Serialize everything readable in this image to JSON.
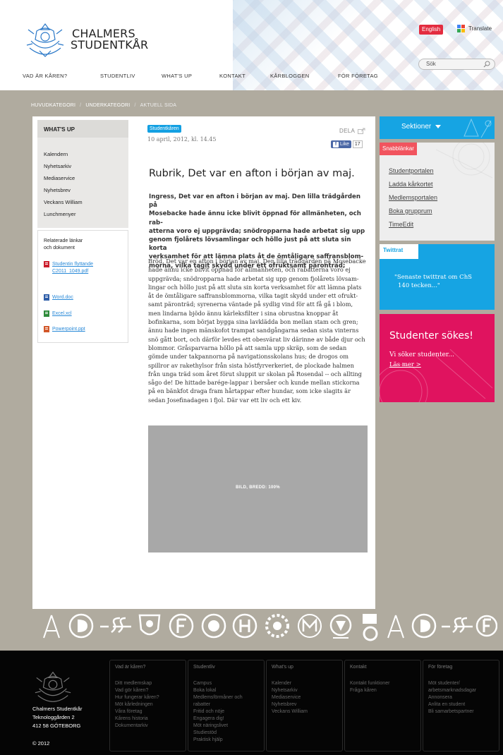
{
  "header": {
    "logo_line1": "CHALMERS",
    "logo_line2": "STUDENTKÅR",
    "lang_button": "English",
    "translate_label": "Translate",
    "search_placeholder": "Sök",
    "nav": [
      "VAD ÄR KÅREN?",
      "STUDENTLIV",
      "WHAT'S UP",
      "KONTAKT",
      "KÅRBLOGGEN",
      "FÖR FÖRETAG"
    ]
  },
  "breadcrumb": [
    "HUVUDKATEGORI",
    "UNDERKATEGORI",
    "AKTUELL SIDA"
  ],
  "sidebar": {
    "title": "WHAT'S UP",
    "items": [
      "Kalendern",
      "Nyhetsarkiv",
      "Mediaservice",
      "Nyhetsbrev",
      "Veckans William",
      "Lunchmenyer"
    ],
    "related_title_1": "Relaterade länkar",
    "related_title_2": "och dokument",
    "docs": [
      {
        "line1": "Studentin flyttande",
        "line2": "C2011_1049.pdf",
        "icon": "pdf-icon",
        "color": "#cc1f2d"
      },
      {
        "line1": "Word.doc",
        "line2": "",
        "icon": "word-icon",
        "color": "#2f5ea8"
      },
      {
        "line1": "Excel.xcl",
        "line2": "",
        "icon": "excel-icon",
        "color": "#2e8b3a"
      },
      {
        "line1": "Powerpoint.ppt",
        "line2": "",
        "icon": "powerpoint-icon",
        "color": "#d2582a"
      }
    ]
  },
  "article": {
    "tag": "Studentkåren",
    "date": "10 april, 2012, kl. 14.45",
    "share_label": "DELA",
    "like_label": "Like",
    "like_count": "17",
    "title": "Rubrik, Det var en afton i början av maj.",
    "ingress_lines": [
      "Ingress, Det var en afton i början av maj. Den lilla trädgården på",
      "Mosebacke hade ännu icke blivit öppnad för allmänheten, och rab-",
      "atterna voro ej uppgrävda; snödropparna hade arbetat sig upp",
      "genom fjolårets lövsamlingar och höllo just på att sluta sin korta",
      "verksamhet för att lämna plats åt de ömtåligare saffransblom-",
      "morna, vilka tagit skydd under ett ofruktsamt päronträd;"
    ],
    "body_lines": [
      "Bröd, Det var en afton i början av maj. Den lilla trädgården på Mosebacke",
      "hade ännu icke blivit öppnad för allmänheten, och rabatterna voro ej",
      "uppgrävda; snödropparna hade arbetat sig upp genom fjolårets lövsam-",
      "lingar och höllo just på att sluta sin korta verksamhet för att lämna plats",
      "åt de ömtåligare saffransblommorna, vilka tagit skydd under ett ofrukt-",
      "samt päronträd; syrenerna väntade på sydlig vind för att få gå i blom,",
      "men lindarna bjödo ännu kärleksfilter i sina obrustna knoppar åt",
      "bofinkarna, som börjat bygga sina lavklädda bon mellan stam och gren;",
      "ännu hade ingen mänskofot trampat sandgångarna sedan sista vinterns",
      "snö gått bort, och därför levdes ett obesvärat liv därinne av både djur och",
      "blommor. Gråsparvarna höllo på att samla upp skräp, som de sedan",
      "gömde under takpannorna på  navigationsskolans hus; de drogos om",
      "spillror av rakethylsor från sista höstfyrverkeriet, de plockade halmen",
      "från unga träd som året förut sluppit ur skolan på Rosendal -- och allting",
      "sågo de! De hittade barége-lappar i bersåer och kunde mellan stickorna",
      "på en bänkfot draga fram hårtappar efter hundar, som icke slagits är",
      "sedan Josefinadagen i fjol. Där var ett liv och ett kiv."
    ],
    "image_label": "BILD, BREDD: 100%"
  },
  "right": {
    "sektioner": "Sektioner",
    "snabb_title": "Snabblänkar",
    "snabb_links": [
      "Studentportalen",
      "Ladda kårkortet",
      "Medlemsportalen",
      "Boka grupprum",
      "TimeEdit"
    ],
    "twitter_title": "Twittrat",
    "tweet_line1": "\"Senaste twittrat om ChS",
    "tweet_line2": "140 tecken...\"",
    "promo_title": "Studenter sökes!",
    "promo_sub": "Vi söker studenter...",
    "promo_link": "Läs mer >"
  },
  "footer": {
    "address": [
      "Chalmers Studentkår",
      "Teknologgården 2",
      "412 58 GÖTEBORG"
    ],
    "copyright": "© 2012",
    "columns": [
      {
        "title": "Vad är kåren?",
        "items": [
          "Ditt medlemskap",
          "Vad gör kåren?",
          "Hur fungerar kåren?",
          "Möt kårledningen",
          "Våra företag",
          "Kårens historia",
          "Dokumentarkiv"
        ]
      },
      {
        "title": "Studentliv",
        "items": [
          "Campus",
          "Boka lokal",
          "Medlemsförmåner och",
          "rabatter",
          "Fritid och nöje",
          "Engagera dig!",
          "Möt näringslivet",
          "Studiestöd",
          "Praktisk hjälp"
        ]
      },
      {
        "title": "What's up",
        "items": [
          "Kalender",
          "Nyhetsarkiv",
          "Mediaservice",
          "Nyhetsbrev",
          "Veckans William"
        ]
      },
      {
        "title": "Kontakt",
        "items": [
          "Kontakt funktioner",
          "Fråga kåren"
        ]
      },
      {
        "title": "För företag",
        "items": [
          "Möt studenter/",
          "arbetsmarknadsdagar",
          "Annonsera",
          "Anlita en student",
          "Bli samarbetspartner"
        ]
      }
    ]
  },
  "colors": {
    "page_bg": "#b0ab9f",
    "accent_blue": "#16a4e3",
    "accent_red": "#f1545e",
    "promo_pink": "#e0135f"
  }
}
